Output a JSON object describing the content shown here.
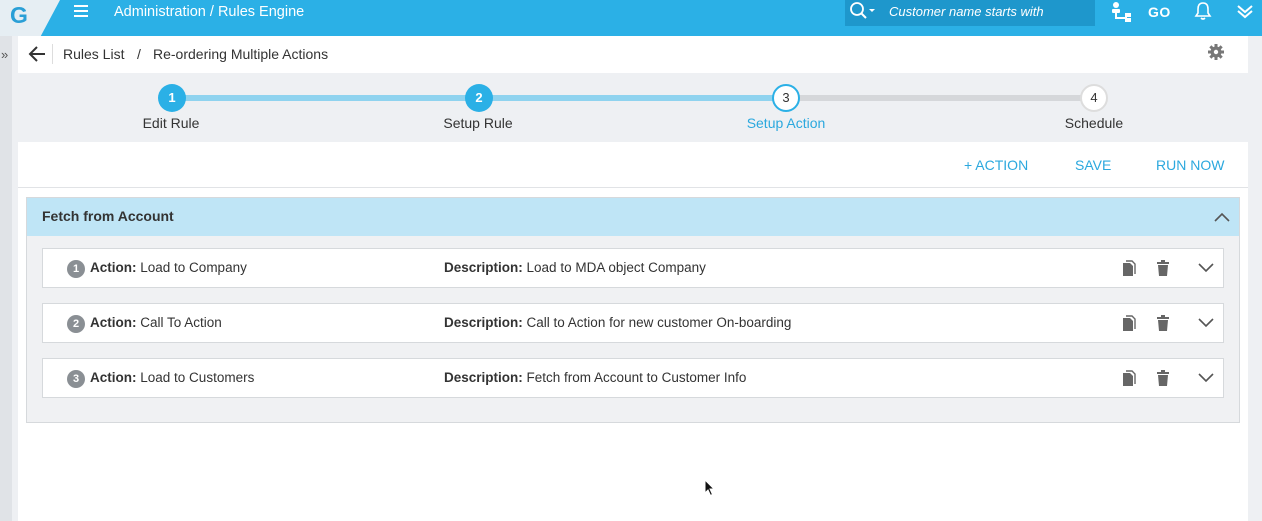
{
  "app": {
    "logo_letter": "G",
    "title": "Administration / Rules Engine",
    "search_placeholder": "Customer name starts with",
    "go_label": "GO",
    "accent_color": "#2bb0e6"
  },
  "breadcrumb": {
    "root": "Rules List",
    "separator": "/",
    "current": "Re-ordering Multiple Actions"
  },
  "stepper": {
    "steps": [
      {
        "number": "1",
        "label": "Edit Rule",
        "state": "done"
      },
      {
        "number": "2",
        "label": "Setup Rule",
        "state": "done"
      },
      {
        "number": "3",
        "label": "Setup Action",
        "state": "active"
      },
      {
        "number": "4",
        "label": "Schedule",
        "state": "todo"
      }
    ]
  },
  "toolbar": {
    "add_action": "+ ACTION",
    "save": "SAVE",
    "run_now": "RUN NOW"
  },
  "section": {
    "title": "Fetch from Account",
    "action_label": "Action:",
    "description_label": "Description:",
    "rows": [
      {
        "number": "1",
        "action": "Load to Company",
        "description": "Load to MDA object Company"
      },
      {
        "number": "2",
        "action": "Call To Action",
        "description": "Call to Action for new customer On-boarding"
      },
      {
        "number": "3",
        "action": "Load to Customers",
        "description": "Fetch from Account to Customer Info"
      }
    ]
  },
  "icons": {
    "menu": "hamburger-icon",
    "search": "search-icon",
    "org": "org-chart-icon",
    "notifications": "bell-icon",
    "user_menu": "chevron-down-icon",
    "back": "arrow-left-icon",
    "settings": "gear-icon",
    "copy": "copy-icon",
    "delete": "trash-icon",
    "expand": "chevron-down-icon",
    "collapse": "chevron-up-icon"
  }
}
